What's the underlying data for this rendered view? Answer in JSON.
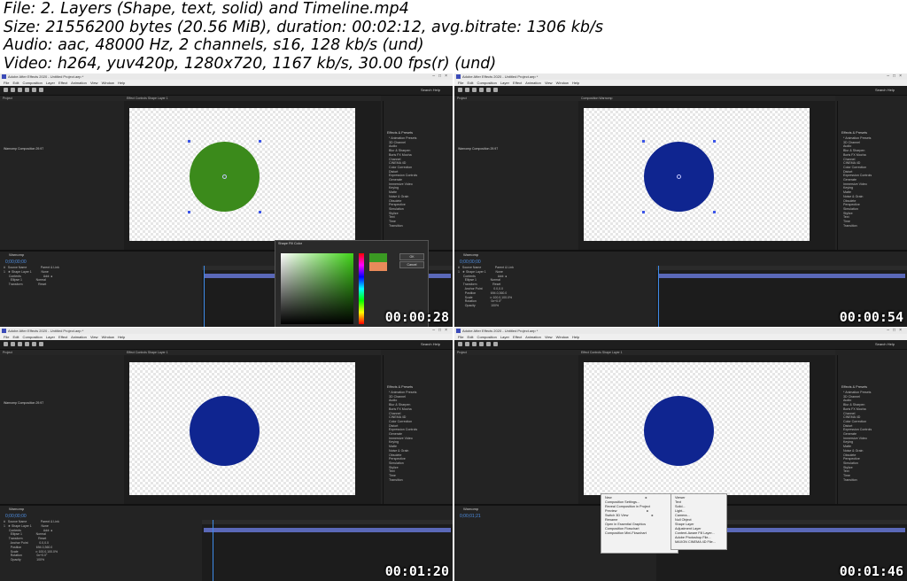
{
  "header": {
    "file_line": "File: 2. Layers (Shape, text, solid) and Timeline.mp4",
    "size_line": "Size: 21556200 bytes (20.56 MiB), duration: 00:02:12, avg.bitrate: 1306 kb/s",
    "audio_line": "Audio: aac, 48000 Hz, 2 channels, s16, 128 kb/s (und)",
    "video_line": "Video: h264, yuv420p, 1280x720, 1167 kb/s, 30.00 fps(r) (und)"
  },
  "app": {
    "title": "Adobe After Effects 2020 - Untitled Project.aep *",
    "menu": "File  Edit  Composition  Layer  Effect  Animation  View  Window  Help",
    "search": "Search Help",
    "project_tab": "Project",
    "effect_controls_tab": "Effect Controls Shape Layer 1",
    "composition_tab": "Composition Warnomp",
    "comp_name": "Warnomp",
    "project_item": "Warnomp          Composition         29.97",
    "effects_title": "Effects & Presets",
    "effects_list": "* Animation Presets\n3D Channel\nAudio\nBlur & Sharpen\nBoris FX Mocha\nChannel\nCINEMA 4D\nColor Correction\nDistort\nExpression Controls\nGenerate\nImmersive Video\nKeying\nMatte\nNoise & Grain\nObsolete\nPerspective\nSimulation\nStylize\nText\nTime\nTransition",
    "timeline_tab": "Warnomp",
    "timecode_a": "0;00;00;00",
    "timecode_b": "0;00;01;21",
    "layers_text": "#   Source Name                Parent & Link\n1   ★ Shape Layer 1           None\n      Contents                          Add: ●\n        Ellipse 1                Normal\n      Transform                  Reset",
    "layers_text_transform": "#   Source Name                Parent & Link\n1   ★ Shape Layer 1           None\n      Contents                          Add: ●\n        Ellipse 1                Normal\n      Transform                  Reset\n        Anchor Point             0.0,0.0\n        Position                 694.0,360.0\n        Scale                    ∞ 100.0,100.0%\n        Rotation                 0x+0.0°\n        Opacity                  100%",
    "toggle": "Toggle Switches / Modes"
  },
  "picker": {
    "title": "Shape Fill Color",
    "ok": "OK",
    "cancel": "Cancel"
  },
  "menus": {
    "context_main": "New                                    ▸\nComposition Settings...\nReveal Composition in Project\nPreview                                ▸\nSwitch 3D View                         ▸\nRename\nOpen in Essential Graphics\nComposition Flowchart\nComposition Mini-Flowchart",
    "context_new": "Viewer\nText\nSolid...\nLight...\nCamera...\nNull Object\nShape Layer\nAdjustment Layer\nContent-Aware Fill Layer...\nAdobe Photoshop File...\nMAXON CINEMA 4D File..."
  },
  "thumbnails": [
    {
      "timestamp": "00:00:28",
      "circle_color": "#3b8a1b"
    },
    {
      "timestamp": "00:00:54",
      "circle_color": "#0f2590"
    },
    {
      "timestamp": "00:01:20",
      "circle_color": "#0f2590"
    },
    {
      "timestamp": "00:01:46",
      "circle_color": "#0f2590"
    }
  ]
}
